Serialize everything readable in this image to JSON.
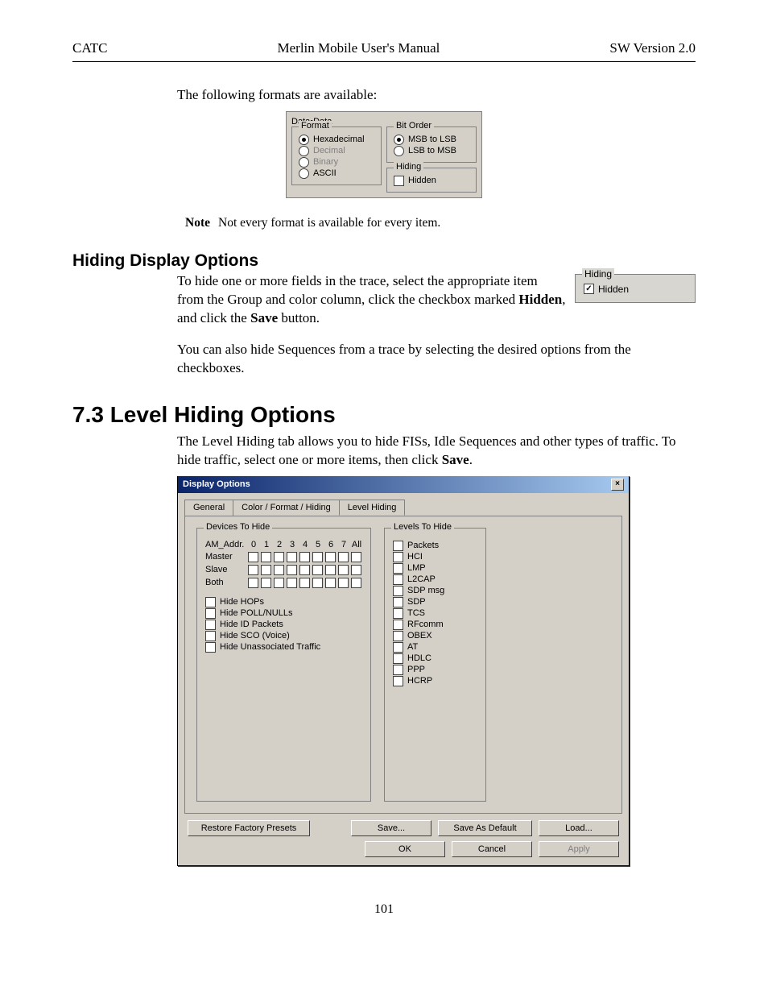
{
  "header": {
    "left": "CATC",
    "center": "Merlin Mobile User's Manual",
    "right": "SW Version 2.0"
  },
  "intro": "The following formats are available:",
  "data_panel": {
    "title": "Data•Data",
    "format": {
      "title": "Format",
      "options": [
        "Hexadecimal",
        "Decimal",
        "Binary",
        "ASCII"
      ],
      "selected": "Hexadecimal",
      "disabled": [
        "Decimal",
        "Binary"
      ]
    },
    "bit_order": {
      "title": "Bit Order",
      "options": [
        "MSB to LSB",
        "LSB to MSB"
      ],
      "selected": "MSB to LSB"
    },
    "hiding": {
      "title": "Hiding",
      "label": "Hidden",
      "checked": false
    }
  },
  "note": {
    "label": "Note",
    "text": "Not every format is available for every item."
  },
  "section_hiding": {
    "heading": "Hiding Display Options",
    "para1_a": "To hide one or more fields in the trace, select the appropriate item from the Group and color column, click the checkbox marked ",
    "para1_b": "Hidden",
    "para1_c": ", and click the ",
    "para1_d": "Save",
    "para1_e": " button.",
    "para2": "You can also hide Sequences from a trace by selecting the desired options from the checkboxes.",
    "side_box": {
      "title": "Hiding",
      "label": "Hidden",
      "checked": true
    }
  },
  "section_level": {
    "heading": "7.3  Level Hiding Options",
    "para_a": "The Level Hiding tab allows you to hide FISs, Idle Sequences and other types of traffic.  To hide traffic, select one or more items, then click ",
    "para_b": "Save",
    "para_c": "."
  },
  "dialog": {
    "title": "Display Options",
    "tabs": [
      "General",
      "Color / Format / Hiding",
      "Level Hiding"
    ],
    "active_tab": "Level Hiding",
    "devices": {
      "title": "Devices To Hide",
      "row_label": "AM_Addr.",
      "cols": [
        "0",
        "1",
        "2",
        "3",
        "4",
        "5",
        "6",
        "7",
        "All"
      ],
      "rows": [
        "Master",
        "Slave",
        "Both"
      ],
      "extra": [
        "Hide HOPs",
        "Hide POLL/NULLs",
        "Hide ID Packets",
        "Hide SCO (Voice)",
        "Hide Unassociated Traffic"
      ]
    },
    "levels": {
      "title": "Levels To Hide",
      "items": [
        "Packets",
        "HCI",
        "LMP",
        "L2CAP",
        "SDP msg",
        "SDP",
        "TCS",
        "RFcomm",
        "OBEX",
        "AT",
        "HDLC",
        "PPP",
        "HCRP"
      ]
    },
    "buttons": {
      "restore": "Restore Factory Presets",
      "save": "Save...",
      "save_default": "Save As Default",
      "load": "Load...",
      "ok": "OK",
      "cancel": "Cancel",
      "apply": "Apply"
    }
  },
  "page_number": "101"
}
